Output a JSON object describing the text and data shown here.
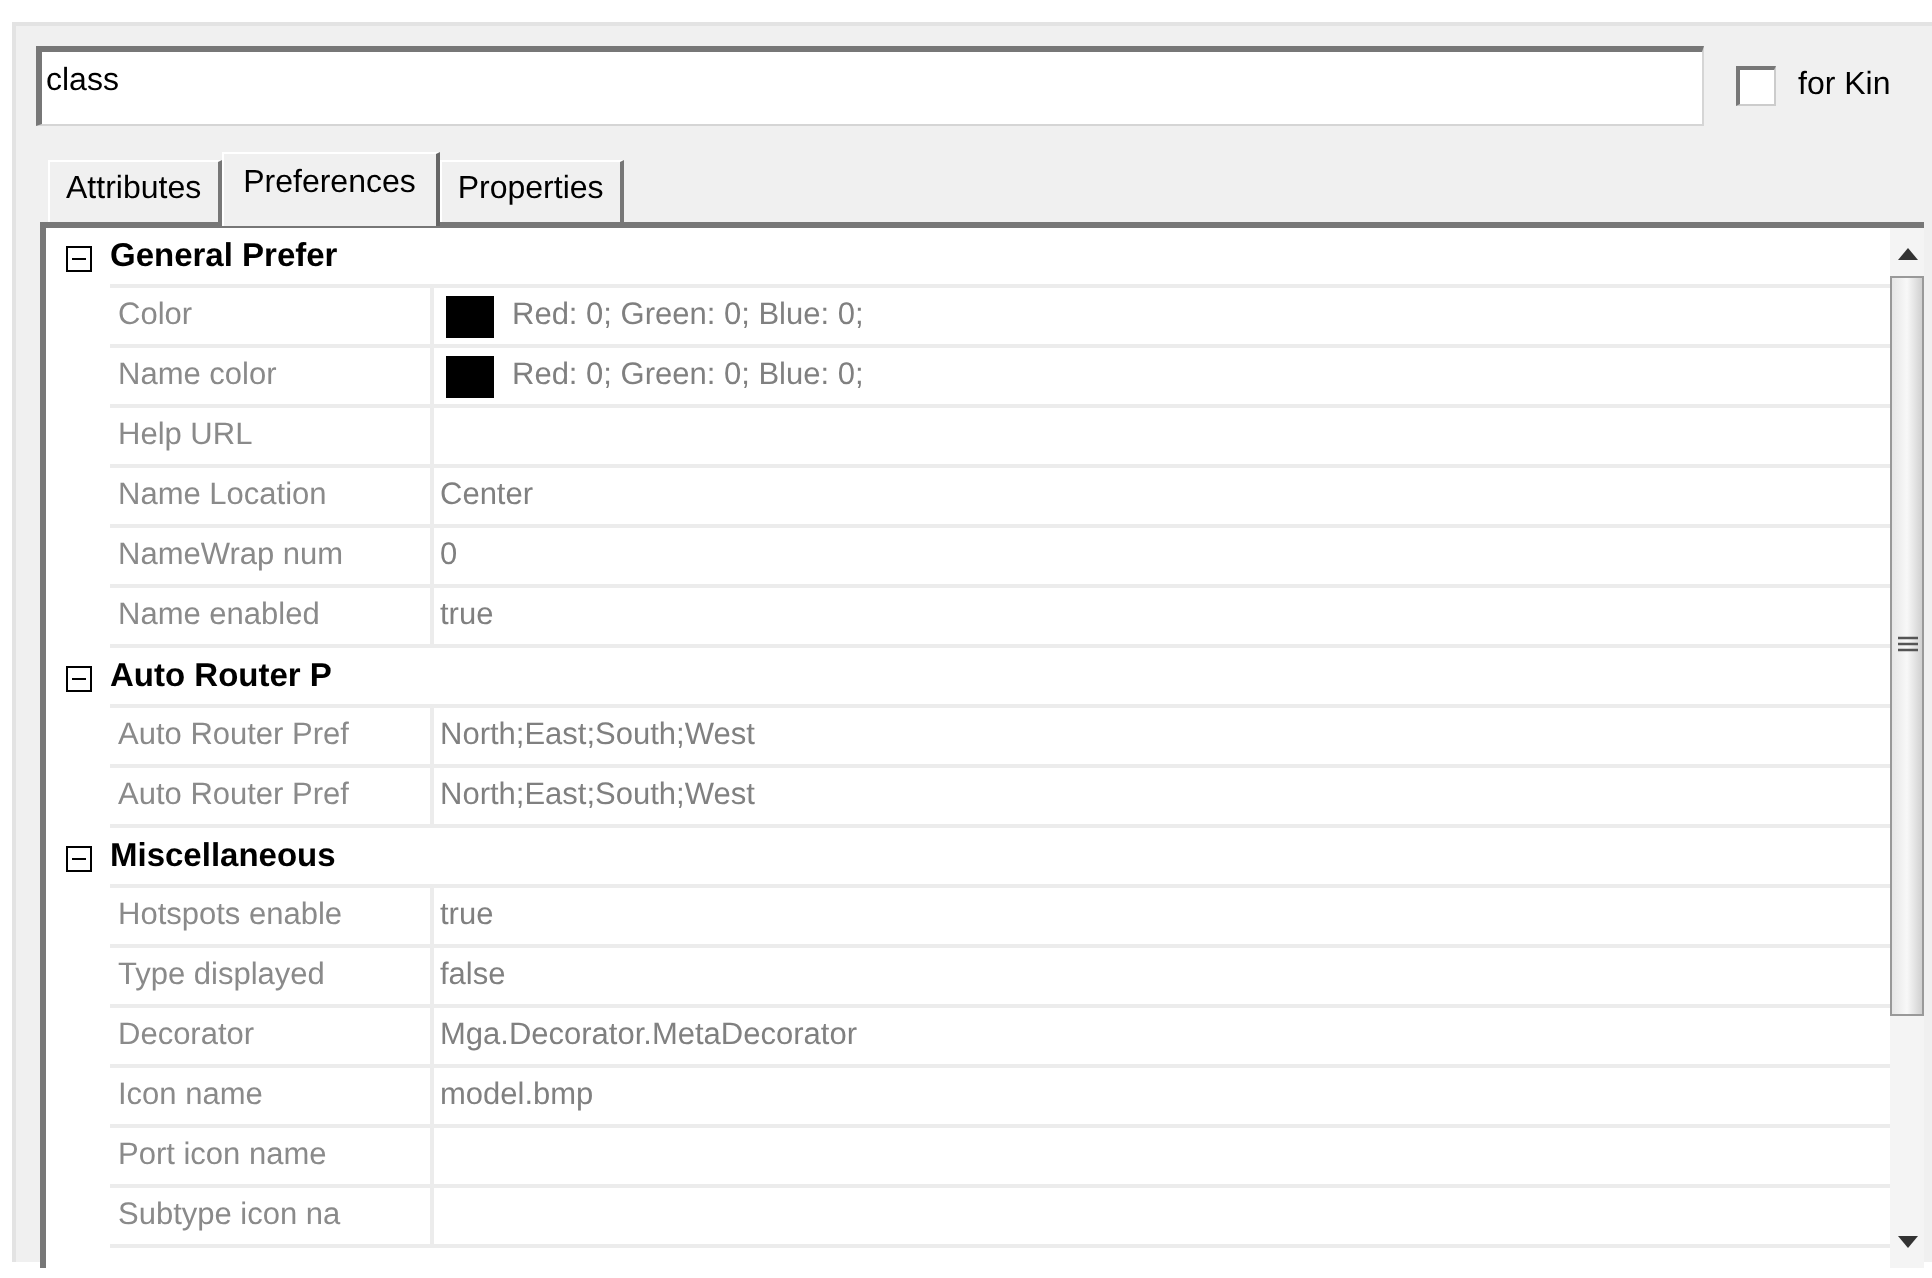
{
  "search": {
    "value": "class"
  },
  "kind_filter": {
    "label": "for Kin",
    "checked": false
  },
  "tabs": [
    {
      "label": "Attributes",
      "selected": false
    },
    {
      "label": "Preferences",
      "selected": true
    },
    {
      "label": "Properties",
      "selected": false
    }
  ],
  "groups": [
    {
      "title": "General Prefer",
      "expanded": true,
      "properties": [
        {
          "name": "Color",
          "value": "Red: 0; Green: 0; Blue: 0;",
          "color": "#000000"
        },
        {
          "name": "Name color",
          "value": "Red: 0; Green: 0; Blue: 0;",
          "color": "#000000"
        },
        {
          "name": "Help URL"
        },
        {
          "name": "Name Location",
          "value": "Center"
        },
        {
          "name": "NameWrap num",
          "value": "0"
        },
        {
          "name": "Name enabled",
          "value": "true"
        }
      ]
    },
    {
      "title": "Auto Router P",
      "expanded": true,
      "properties": [
        {
          "name": "Auto Router Pref",
          "value": "North;East;South;West"
        },
        {
          "name": "Auto Router Pref",
          "value": "North;East;South;West"
        }
      ]
    },
    {
      "title": "Miscellaneous",
      "expanded": true,
      "properties": [
        {
          "name": "Hotspots enable",
          "value": "true"
        },
        {
          "name": "Type displayed",
          "value": "false"
        },
        {
          "name": "Decorator",
          "value": "Mga.Decorator.MetaDecorator"
        },
        {
          "name": "Icon name",
          "value": "model.bmp"
        },
        {
          "name": "Port icon name"
        },
        {
          "name": "Subtype icon na"
        }
      ]
    }
  ]
}
